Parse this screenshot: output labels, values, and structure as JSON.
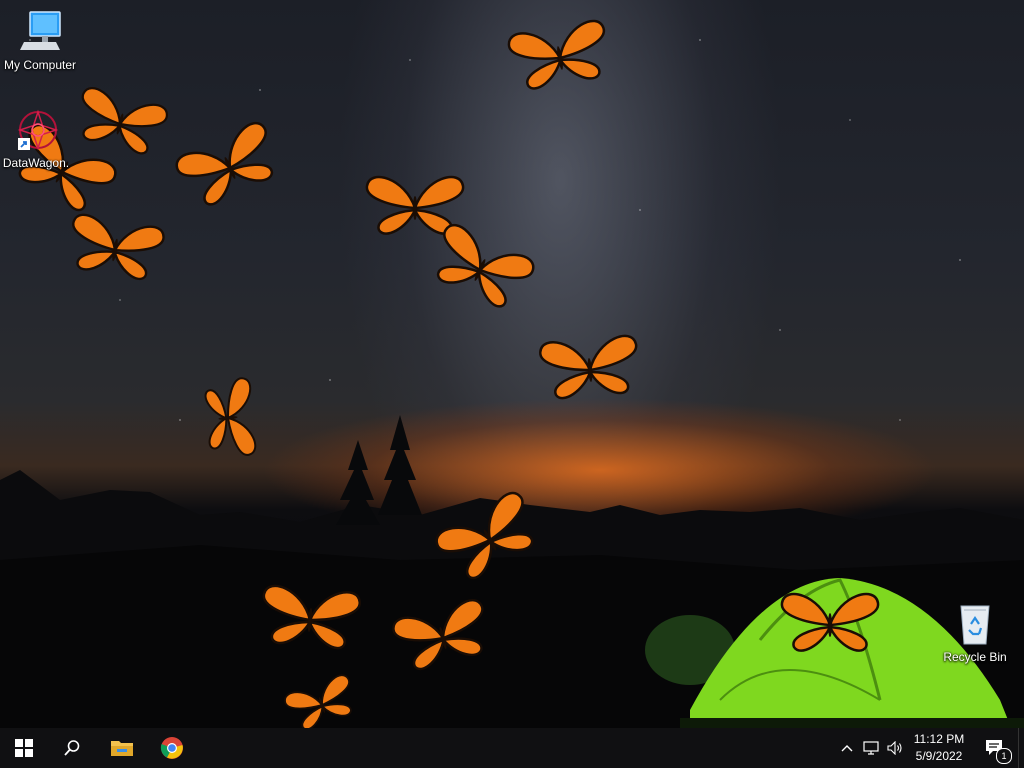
{
  "desktop_icons": [
    {
      "label": "My Computer",
      "icon": "computer-icon"
    },
    {
      "label": "DataWagon.",
      "icon": "datawagon-shortcut-icon"
    },
    {
      "label": "Recycle Bin",
      "icon": "recycle-bin-icon"
    }
  ],
  "wallpaper": {
    "subject": "night sky with milky way, mountains, glowing green tent, monarch butterflies",
    "accent_colors": {
      "horizon_glow": "#e0701e",
      "tent": "#7fd81f",
      "butterfly": "#f07a12"
    }
  },
  "taskbar": {
    "start_icon": "windows-logo-icon",
    "search_icon": "search-icon",
    "pinned": [
      {
        "name": "file-explorer",
        "icon": "folder-icon"
      },
      {
        "name": "chrome",
        "icon": "chrome-icon"
      }
    ],
    "tray_icons": [
      "chevron-up-icon",
      "network-icon",
      "volume-icon"
    ],
    "clock": {
      "time": "11:12 PM",
      "date": "5/9/2022"
    },
    "notification_count": "1"
  }
}
